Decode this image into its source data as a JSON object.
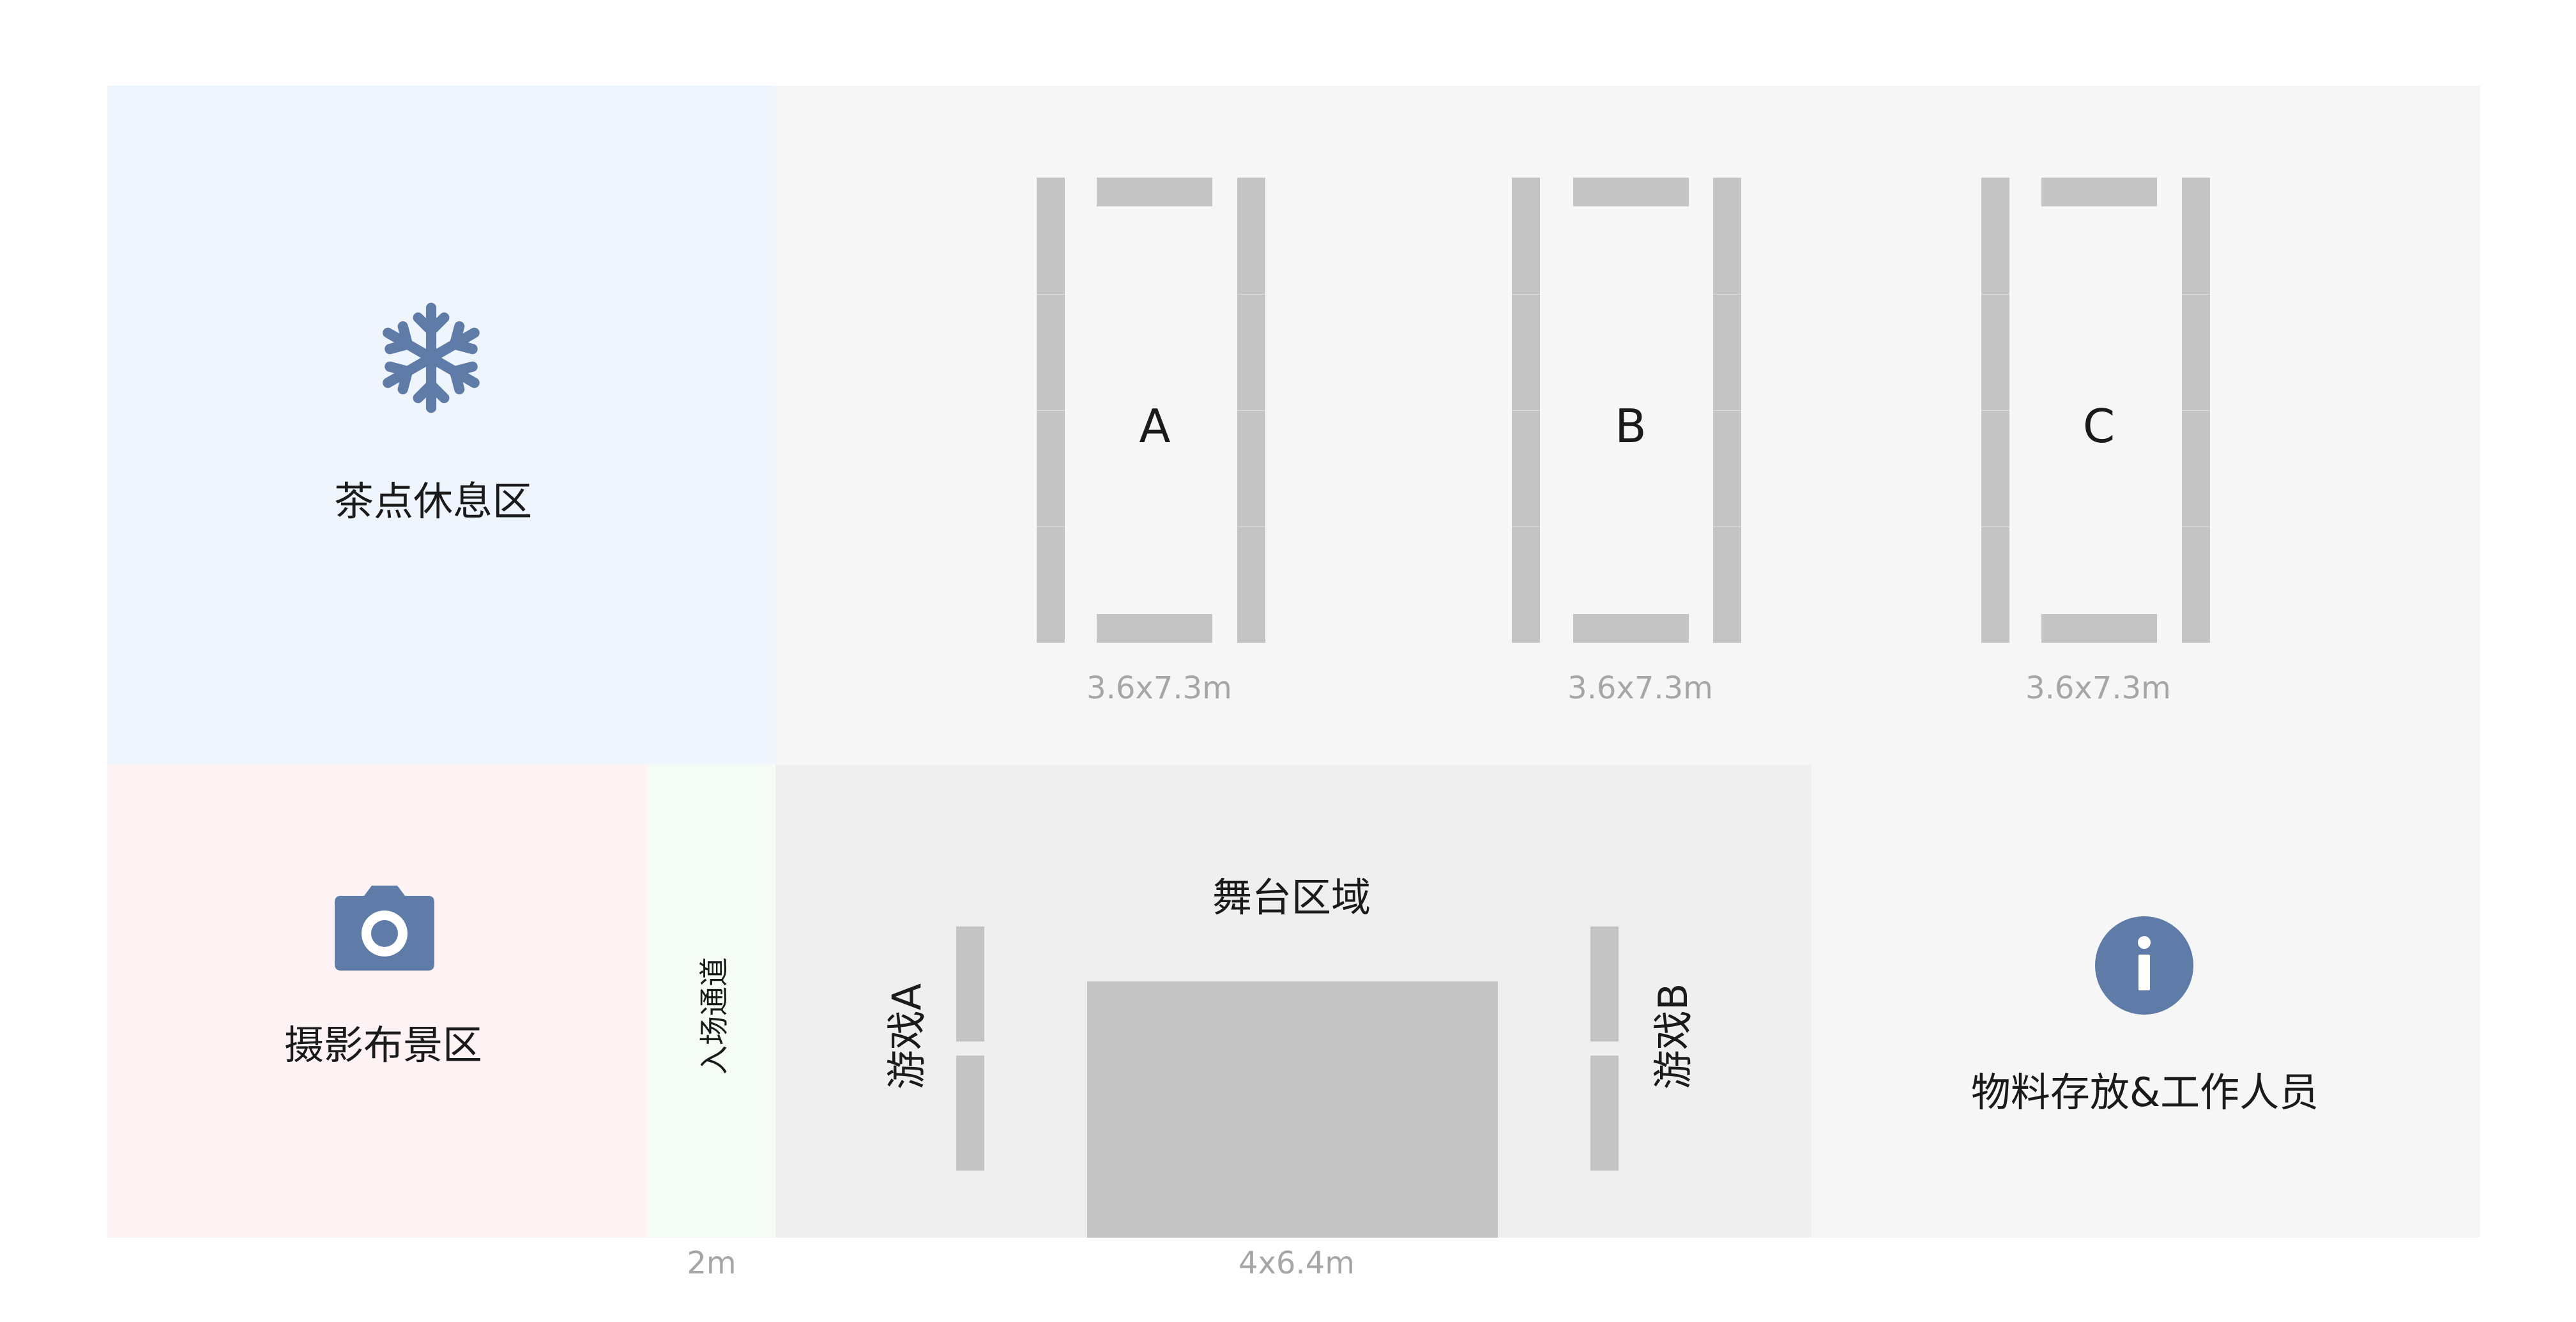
{
  "zones": {
    "tea_break": {
      "label": "茶点休息区",
      "icon": "snowflake-icon"
    },
    "photo_area": {
      "label": "摄影布景区",
      "icon": "camera-icon"
    },
    "entrance": {
      "label": "入场通道",
      "width_label": "2m"
    },
    "stage_area": {
      "label": "舞台区域",
      "size_label": "4x6.4m"
    },
    "game_a": {
      "label": "游戏A"
    },
    "game_b": {
      "label": "游戏B"
    },
    "materials": {
      "label": "物料存放&工作人员",
      "icon": "info-icon"
    }
  },
  "booths": [
    {
      "label": "A",
      "size_label": "3.6x7.3m"
    },
    {
      "label": "B",
      "size_label": "3.6x7.3m"
    },
    {
      "label": "C",
      "size_label": "3.6x7.3m"
    }
  ],
  "colors": {
    "background": "#ffffff",
    "main_floor": "#f6f6f6",
    "tea_break": "#eef5fc",
    "photo_area": "#fdf3f4",
    "entrance": "#f5fbf5",
    "stage_area": "#efefef",
    "furniture": "#c4c4c4",
    "icon": "#5f7ca8",
    "dim_text": "#a6a6a6"
  }
}
